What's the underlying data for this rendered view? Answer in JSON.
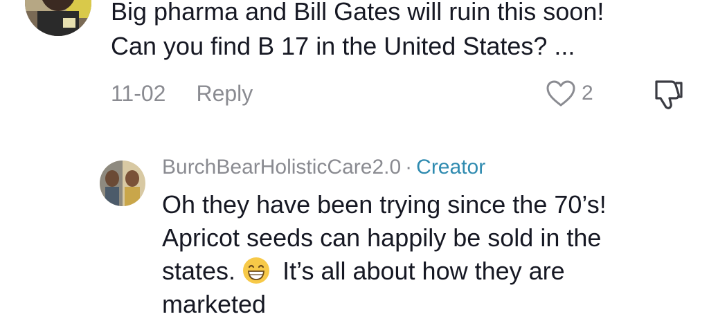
{
  "comment": {
    "lines": [
      "Big pharma and Bill Gates will ruin this soon!",
      "Can you find B 17 in the United States? ..."
    ],
    "date": "11-02",
    "reply_label": "Reply",
    "like_count": "2",
    "icons": {
      "like": "heart-outline-icon",
      "dislike": "thumbs-down-icon"
    }
  },
  "reply": {
    "username": "BurchBearHolisticCare2.0",
    "separator": "·",
    "role_badge": "Creator",
    "line1": "Oh they have been trying since the 70’s!",
    "line2": "Apricot seeds can happily be sold in the",
    "line3_prefix": "states.",
    "line3_suffix": "It’s all about how they are",
    "line4": "marketed",
    "emoji": "grinning-face-emoji"
  },
  "colors": {
    "text": "#161823",
    "muted": "#8a8b91",
    "creator": "#2f8bb0"
  }
}
